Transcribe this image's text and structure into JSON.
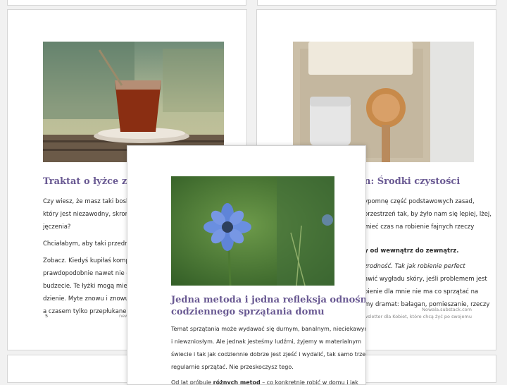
{
  "left_page": {
    "title": "Traktat o łyżce z T",
    "lines": [
      "Czy wiesz, że masz taki boski prz",
      "który jest niezawodny, skromny",
      "jęczenia?",
      "Chciałabym, aby taki przedmiot t",
      "Zobacz. Kiedyś kupiłaś komplet s",
      "prawdopodobnie nawet nie odcz",
      "budzecie. Te łyżki mogą mieć już",
      "dzienie. Myte znowu i znowu, a",
      "a czasem tylko przepłukane. I wo"
    ],
    "page_number": "5",
    "footer_fragment": "new"
  },
  "right_page": {
    "title": "n: Środki czystości",
    "lines": [
      "ypomnę część podstawowych zasad,",
      "orzestrzeń tak, by żyło nam się lepiej, lżej,",
      "mieć czas na robienie fajnych rzeczy",
      "y od wewnątrz do zewnątrz.",
      "zrodność. Tak jak robienie perfect",
      "awić wygładu skóry, jeśli problemem jest",
      "bienie dla mnie nie ma co sprzątać na",
      "my dramat: bałagan, pomieszanie, rzeczy"
    ],
    "footer_site": "Nowala.substack.com",
    "footer_tagline": "newsletter dla Kobiet, które chcą żyć po swojemu"
  },
  "front_page": {
    "title_line1": "Jedna metoda i jedna refleksja odnośnie",
    "title_line2": "codziennego sprzątania domu",
    "lines": [
      "Temat sprzątania może wydawać się durnym, banalnym, nieciekawym",
      "i niewzniosłym. Ale jednak jesteśmy ludźmi, żyjemy w materialnym",
      "świecie i tak jak codziennie dobrze jest zjeść i wydalić, tak samo trzeba",
      "regularnie sprzątać. Nie przeskoczysz tego."
    ],
    "last_line_prefix": "Od lat próbuję ",
    "last_line_bold": "różnych metod",
    "last_line_suffix": " – co konkretnie robić w domu i jak"
  },
  "images": {
    "tea": "tea-glass-photo",
    "toiletries": "soap-and-brush-photo",
    "flower": "blue-flower-photo"
  },
  "colors": {
    "title": "#6a5a93",
    "background": "#f1f1f1"
  }
}
